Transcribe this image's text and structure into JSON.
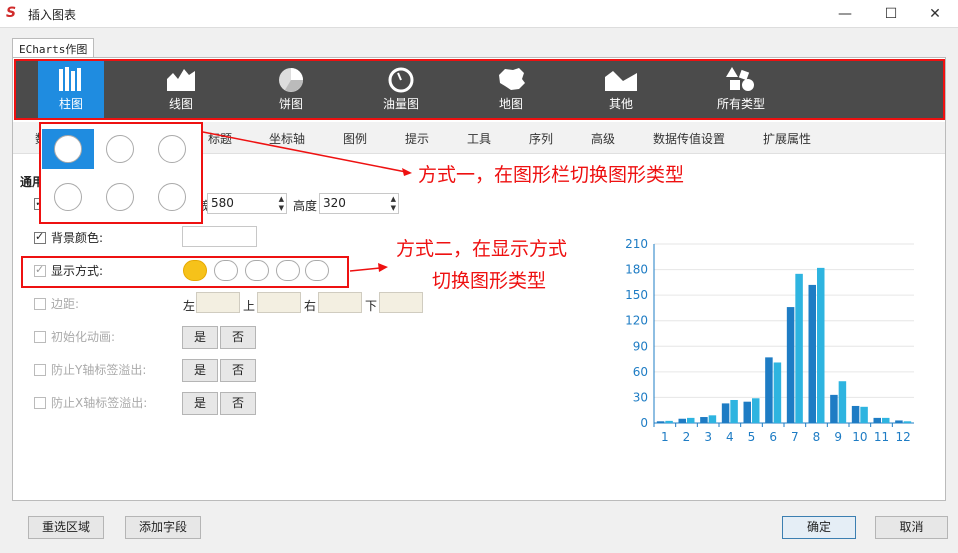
{
  "window": {
    "title": "插入图表",
    "app_icon": "S",
    "minimize": "—",
    "maximize": "☐",
    "close": "✕"
  },
  "tab": "ECharts作图",
  "toolbar": [
    {
      "label": "柱图",
      "icon": "bar-chart-icon",
      "selected": true
    },
    {
      "label": "线图",
      "icon": "line-area-chart-icon"
    },
    {
      "label": "饼图",
      "icon": "pie-chart-icon"
    },
    {
      "label": "油量图",
      "icon": "gauge-icon"
    },
    {
      "label": "地图",
      "icon": "map-icon"
    },
    {
      "label": "其他",
      "icon": "other-chart-icon"
    },
    {
      "label": "所有类型",
      "icon": "all-types-icon"
    }
  ],
  "subtabs": [
    "数据",
    "标题",
    "坐标轴",
    "图例",
    "提示",
    "工具",
    "序列",
    "高级",
    "数据传值设置",
    "扩展属性"
  ],
  "section_label": "通用",
  "fields": {
    "width_label": "宽",
    "width_value": "580",
    "height_label": "高度",
    "height_value": "320",
    "bg_label": "背景颜色:",
    "mode_label": "显示方式:",
    "margin_label": "边距:",
    "margin_left": "左",
    "margin_top": "上",
    "margin_right": "右",
    "margin_bottom": "下",
    "anim_label": "初始化动画:",
    "y_overflow_label": "防止Y轴标签溢出:",
    "x_overflow_label": "防止X轴标签溢出:",
    "yes": "是",
    "no": "否"
  },
  "annotations": {
    "method1": "方式一，在图形栏切换图形类型",
    "method2_line1": "方式二，在显示方式",
    "method2_line2": "切换图形类型"
  },
  "buttons": {
    "reselect": "重选区域",
    "add_field": "添加字段",
    "ok": "确定",
    "cancel": "取消"
  },
  "colors": {
    "accent": "#1f8ce0",
    "toolbar_bg": "#4b4b4b",
    "annotation": "#e11111",
    "bar_dark": "#1e7cc4",
    "bar_light": "#2eb4e0"
  },
  "chart_data": {
    "type": "bar",
    "categories": [
      "1",
      "2",
      "3",
      "4",
      "5",
      "6",
      "7",
      "8",
      "9",
      "10",
      "11",
      "12"
    ],
    "series": [
      {
        "values": [
          2,
          5,
          7,
          23,
          25,
          77,
          136,
          162,
          33,
          20,
          6,
          3
        ]
      },
      {
        "values": [
          2.5,
          6,
          9,
          27,
          29,
          71,
          175,
          182,
          49,
          19,
          6,
          2
        ]
      }
    ],
    "yticks": [
      0,
      30,
      60,
      90,
      120,
      150,
      180,
      210
    ],
    "ylim": [
      0,
      210
    ],
    "grid": true
  }
}
